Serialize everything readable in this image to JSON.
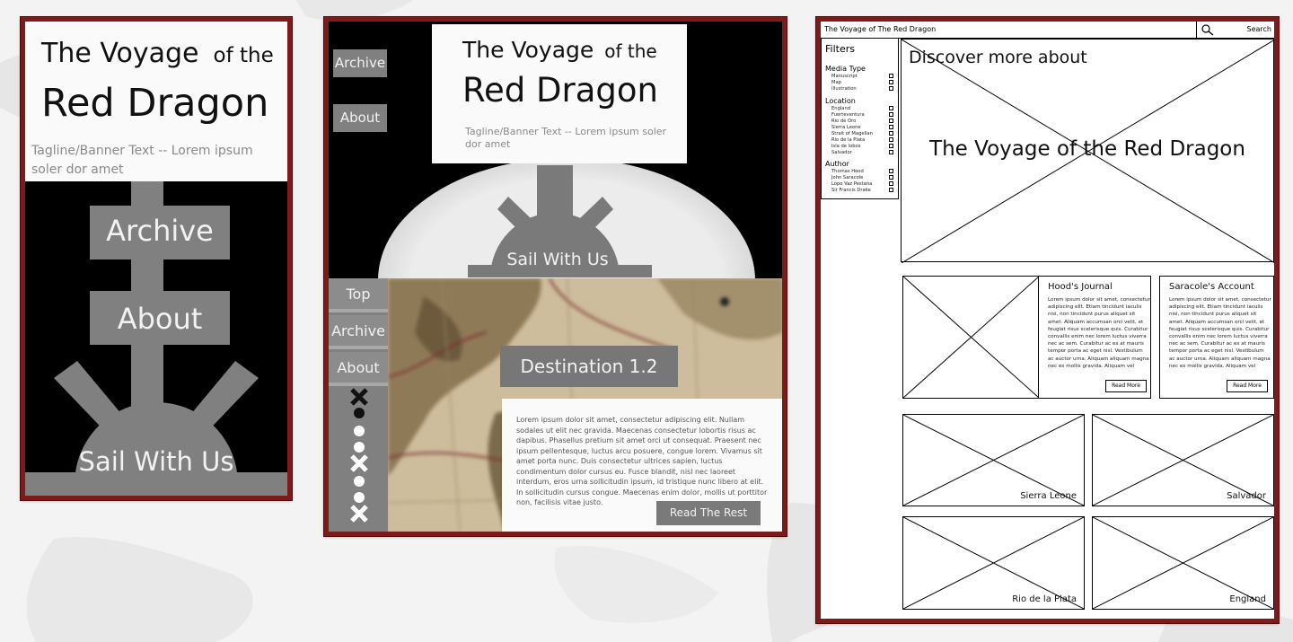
{
  "colors": {
    "frame": "#7d1a1a",
    "gray_button": "#808080",
    "header_bg": "#fafafa",
    "black_bg": "#000000",
    "map_tone": "#c9b99a"
  },
  "mobile": {
    "title_main": "The Voyage",
    "title_small": "of the",
    "title_line2": "Red Dragon",
    "tagline": "Tagline/Banner Text -- Lorem ipsum soler dor amet",
    "nav": [
      "Archive",
      "About"
    ],
    "sail_label": "Sail With Us"
  },
  "tablet": {
    "title_main": "The Voyage",
    "title_small": "of the",
    "title_line2": "Red Dragon",
    "tagline": "Tagline/Banner Text -- Lorem ipsum soler dor amet",
    "top_nav": [
      "Archive",
      "About"
    ],
    "sail_label": "Sail With Us",
    "sidebar_nav": [
      "Top",
      "Archive",
      "About"
    ],
    "timeline_icons": [
      "x-icon",
      "dot-filled",
      "dot",
      "dot",
      "x-icon",
      "dot",
      "dot",
      "x-icon"
    ],
    "destination": "Destination 1.2",
    "body": "Lorem ipsum dolor sit amet, consectetur adipiscing elit. Nullam sodales ut elit nec gravida. Maecenas consectetur lobortis risus ac dapibus. Phasellus pretium sit amet orci ut consequat. Praesent nec ipsum pellentesque, luctus arcu posuere, congue lorem. Vivamus sit amet porta nunc. Duis consectetur ultrices sapien, luctus condimentum dolor cursus eu. Fusce blandit, nisl nec laoreet interdum, eros urna sollicitudin ipsum, id tristique nunc libero at elit. In sollicitudin cursus congue. Maecenas enim dolor, mollis ut porttitor non, facilisis vitae justo.",
    "read_rest": "Read The Rest"
  },
  "desktop": {
    "title": "The Voyage of The Red Dragon",
    "search_label": "Search",
    "filters": {
      "heading": "Filters",
      "sections": [
        {
          "name": "Media Type",
          "items": [
            "Manuscript",
            "Map",
            "Illustration"
          ]
        },
        {
          "name": "Location",
          "items": [
            "England",
            "Fuerteventura",
            "Rio de Oro",
            "Sierra Leone",
            "Strait of Magellan",
            "Rio de la Plata",
            "Isla de lobos",
            "Salvador"
          ]
        },
        {
          "name": "Author",
          "items": [
            "Thomas Hood",
            "John Saracole",
            "Lopo Vaz Pestana",
            "Sir Francis Drake"
          ]
        }
      ]
    },
    "hero_small": "Discover more about",
    "hero_title": "The Voyage of the Red Dragon",
    "articles": [
      {
        "title": "Hood's Journal",
        "body": "Lorem ipsum dolor sit amet, consectetur adipiscing elit. Etiam tincidunt iaculis nisi, non tincidunt purus aliquet sit amet. Aliquam accumsan orci velit, et feugiat risus scelerisque quis. Curabitur convallis enim nec lorem luctus viverra nec ac sem. Curabitur ac ex at mauris tempor porta ac eget nisl. Vestibulum ac auctor urna. Aliquam aliquam magna nec ex mollis gravida. Aliquam vel",
        "button": "Read More"
      },
      {
        "title": "Saracole's Account",
        "body": "Lorem ipsum dolor sit amet, consectetur adipiscing elit. Etiam tincidunt iaculis nisi, non tincidunt purus aliquet sit amet. Aliquam accumsan orci velit, et feugiat risus scelerisque quis. Curabitur convallis enim nec lorem luctus viverra nec ac sem. Curabitur ac ex at mauris tempor porta ac eget nisl. Vestibulum ac auctor urna. Aliquam aliquam magna nec ex mollis gravida. Aliquam vel",
        "button": "Read More"
      }
    ],
    "locations": [
      "Sierra Leone",
      "Salvador",
      "Rio de la Plata",
      "England"
    ]
  }
}
